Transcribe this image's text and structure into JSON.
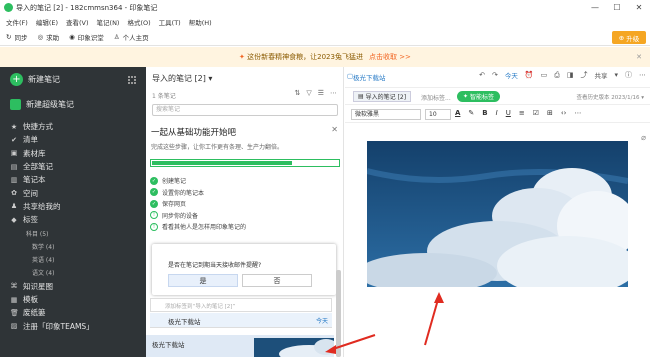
{
  "window": {
    "title": "导入的笔记 [2] - 182cmmsn364 - 印象笔记"
  },
  "menu": [
    "文件(F)",
    "编辑(E)",
    "查看(V)",
    "笔记(N)",
    "格式(O)",
    "工具(T)",
    "帮助(H)"
  ],
  "toolbar": {
    "sync": "同步",
    "help": "求助",
    "account": "印象识堂",
    "profile": "个人主页",
    "upgrade": "升级"
  },
  "banner": {
    "text": "这份新春精神食粮，让2023兔飞猛进",
    "cta": "点击收取 >>"
  },
  "sidebar": {
    "new_note": "新建笔记",
    "new_super": "新建超级笔记",
    "items": [
      {
        "label": "快捷方式",
        "icon": "star-icon",
        "level": 0
      },
      {
        "label": "清单",
        "icon": "check-icon",
        "level": 0
      },
      {
        "label": "素材库",
        "icon": "box-icon",
        "level": 0
      },
      {
        "label": "全部笔记",
        "icon": "note-icon",
        "level": 0
      },
      {
        "label": "笔记本",
        "icon": "notebook-icon",
        "level": 0
      },
      {
        "label": "空间",
        "icon": "space-icon",
        "level": 0
      },
      {
        "label": "共享给我的",
        "icon": "people-icon",
        "level": 0
      },
      {
        "label": "标签",
        "icon": "tag-icon",
        "level": 0
      },
      {
        "label": "科目 (5)",
        "icon": "",
        "level": 1
      },
      {
        "label": "数学 (4)",
        "icon": "",
        "level": 2
      },
      {
        "label": "英语 (4)",
        "icon": "",
        "level": 2
      },
      {
        "label": "语文 (4)",
        "icon": "",
        "level": 2
      },
      {
        "label": "知识星图",
        "icon": "graph-icon",
        "level": 0
      },
      {
        "label": "模板",
        "icon": "template-icon",
        "level": 0
      },
      {
        "label": "废纸篓",
        "icon": "trash-icon",
        "level": 0
      },
      {
        "label": "注册「印象TEAMS」",
        "icon": "team-icon",
        "level": 0
      }
    ]
  },
  "notelist": {
    "header": "导入的笔记 [2] ▾",
    "count": "1 条笔记",
    "search_placeholder": "搜索笔记",
    "guide": {
      "title": "一起从基础功能开始吧",
      "subtitle": "完成这些步骤，让你工作更有条理、生产力翻倍。",
      "progress": 0.75,
      "steps": [
        {
          "label": "创建笔记",
          "done": true
        },
        {
          "label": "设置你的笔记本",
          "done": true
        },
        {
          "label": "保存网页",
          "done": true
        },
        {
          "label": "同步你的设备",
          "done": false
        },
        {
          "label": "看看其他人是怎样用印象笔记的",
          "done": false
        }
      ]
    },
    "popup": {
      "question": "是否在笔记到期当天接收邮件提醒?",
      "yes": "是",
      "no": "否"
    },
    "add_tag_hint": "添加标签到“导入的笔记 [2]”",
    "note_item": {
      "title": "极光下载站",
      "date": "今天"
    },
    "note_item2": {
      "title": "极光下载站"
    }
  },
  "editor": {
    "notebook": "极光下载站",
    "today": "今天",
    "share": "共享",
    "chip": "导入的笔记 [2]",
    "tag_hint": "添加标签...",
    "smart_tag": "智能标签",
    "meta_right": "查看历史版本   2023/1/16 ▾",
    "font": "微软雅黑",
    "size": "10"
  }
}
